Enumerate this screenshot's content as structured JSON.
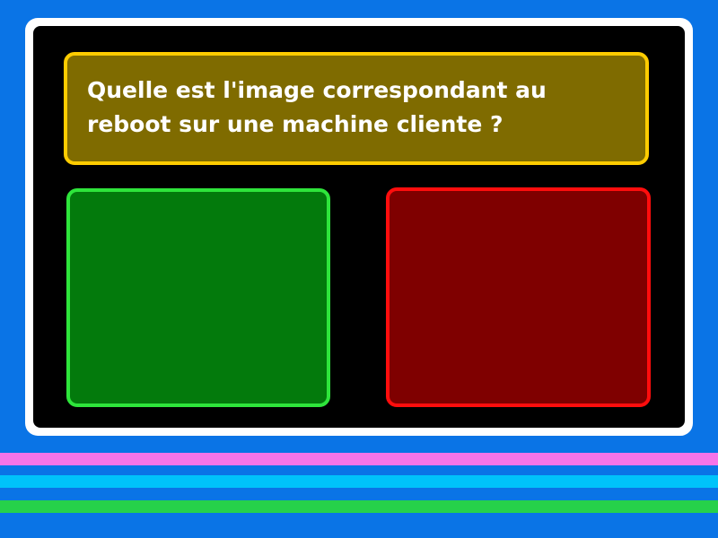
{
  "question": {
    "text": "Quelle est l'image correspondant au reboot sur une machine cliente ?"
  },
  "answers": [
    {
      "id": "left",
      "border_color": "#2ee53b",
      "fill_color": "#037a0c"
    },
    {
      "id": "right",
      "border_color": "#ff0d0d",
      "fill_color": "#7f0000"
    }
  ],
  "colors": {
    "background": "#0a74e6",
    "board": "#000000",
    "frame": "#ffffff",
    "question_fill": "#7f6b00",
    "question_border": "#ffcc00",
    "stripes": [
      "#f774e8",
      "#00c3fa",
      "#26d14a"
    ]
  }
}
